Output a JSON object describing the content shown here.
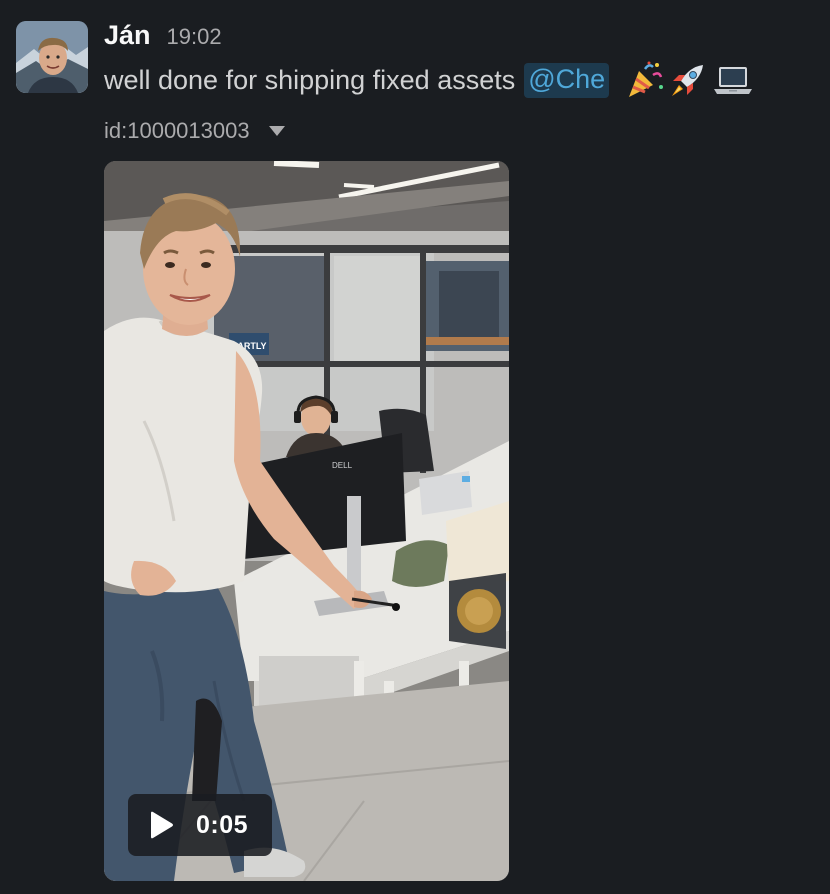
{
  "message": {
    "author": "Ján",
    "time": "19:02",
    "text": "well done for shipping fixed assets",
    "mention": "@Che",
    "emojis": [
      "party-popper-icon",
      "rocket-icon",
      "laptop-icon"
    ]
  },
  "attachment": {
    "file_id": "id:1000013003",
    "video": {
      "duration": "0:05",
      "monitor_brand": "DELL",
      "sign_text": "PARTLY"
    }
  },
  "colors": {
    "background": "#1a1d21",
    "mention_bg": "#1d3a4e",
    "mention_text": "#4fa8d9",
    "author": "#f8f8f8",
    "muted": "#ababad"
  }
}
